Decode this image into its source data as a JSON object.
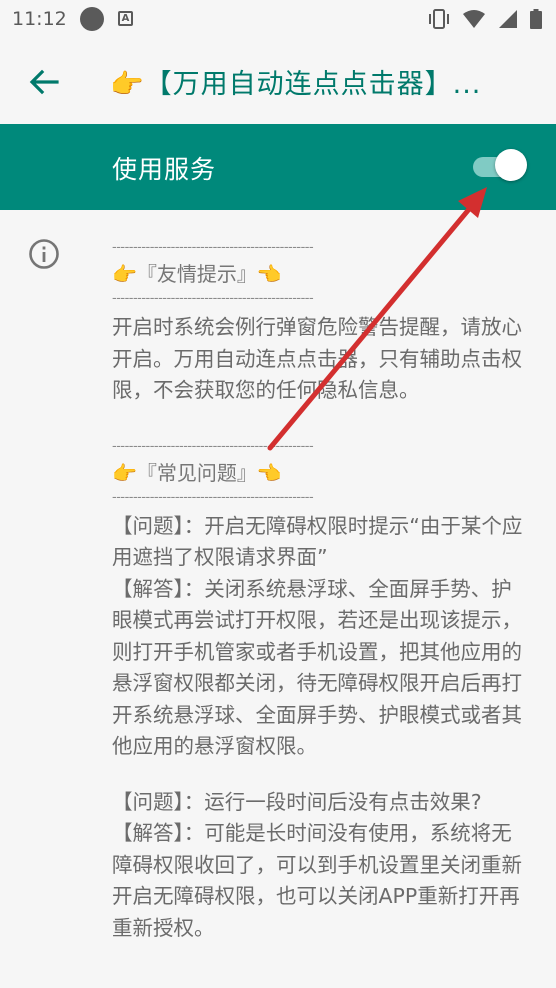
{
  "status_bar": {
    "time": "11:12",
    "icons": [
      "notification-dot-icon",
      "accessibility-a-icon",
      "vibrate-icon",
      "wifi-icon",
      "signal-icon",
      "battery-icon"
    ]
  },
  "app_bar": {
    "back_icon": "arrow-back-icon",
    "title": "👉【万用自动连点点击器】..."
  },
  "switch_bar": {
    "label": "使用服务",
    "enabled": true,
    "color": "#00897b"
  },
  "content": {
    "divider": "------------------------------------------------",
    "tips_title": "『友情提示』",
    "tips_text": "开启时系统会例行弹窗危险警告提醒，请放心开启。万用自动连点点击器，只有辅助点击权限，不会获取您的任何隐私信息。",
    "faq_title": "『常见问题』",
    "faq": [
      {
        "q": "【问题】：开启无障碍权限时提示“由于某个应用遮挡了权限请求界面”",
        "a": "【解答】：关闭系统悬浮球、全面屏手势、护眼模式再尝试打开权限，若还是出现该提示，则打开手机管家或者手机设置，把其他应用的悬浮窗权限都关闭，待无障碍权限开启后再打开系统悬浮球、全面屏手势、护眼模式或者其他应用的悬浮窗权限。"
      },
      {
        "q": "【问题】：运行一段时间后没有点击效果?",
        "a": "【解答】：可能是长时间没有使用，系统将无障碍权限收回了，可以到手机设置里关闭重新开启无障碍权限，也可以关闭APP重新打开再重新授权。"
      }
    ]
  },
  "colors": {
    "accent": "#00897b",
    "title": "#00796b",
    "arrow": "#d32f2f"
  }
}
